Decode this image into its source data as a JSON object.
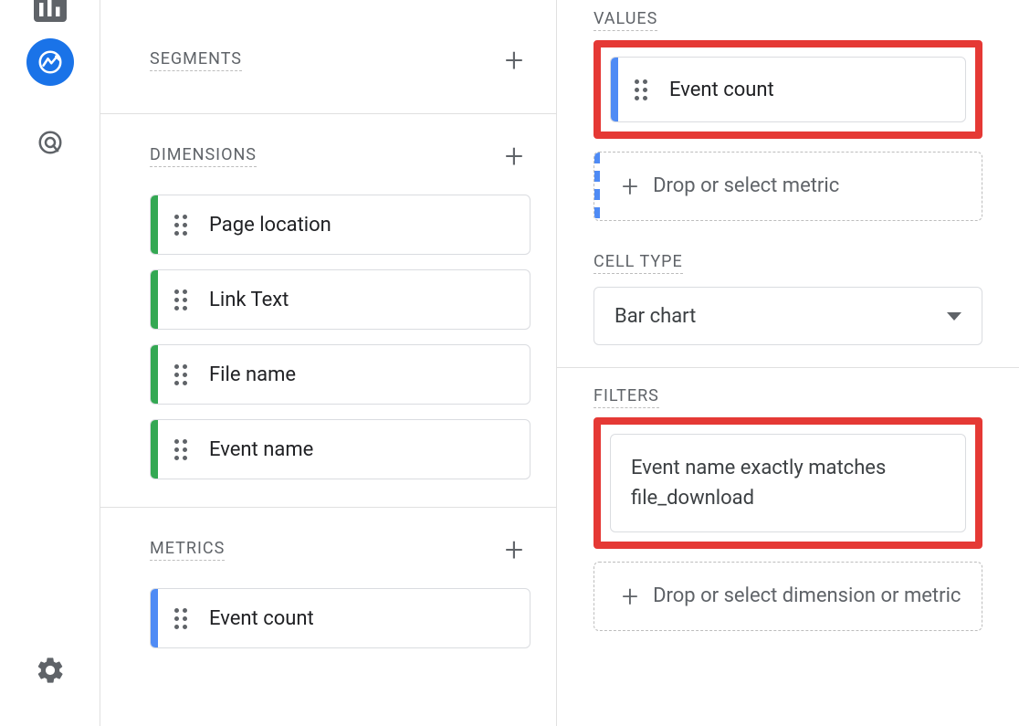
{
  "leftPanel": {
    "segments": {
      "label": "SEGMENTS"
    },
    "dimensions": {
      "label": "DIMENSIONS",
      "items": [
        {
          "label": "Page location"
        },
        {
          "label": "Link Text"
        },
        {
          "label": "File name"
        },
        {
          "label": "Event name"
        }
      ]
    },
    "metrics": {
      "label": "METRICS",
      "items": [
        {
          "label": "Event count"
        }
      ]
    }
  },
  "rightPanel": {
    "values": {
      "label": "VALUES",
      "items": [
        {
          "label": "Event count"
        }
      ],
      "dropText": "Drop or select metric"
    },
    "cellType": {
      "label": "CELL TYPE",
      "selected": "Bar chart"
    },
    "filters": {
      "label": "FILTERS",
      "applied": "Event name exactly matches file_download",
      "dropText": "Drop or select dimension or metric"
    }
  }
}
